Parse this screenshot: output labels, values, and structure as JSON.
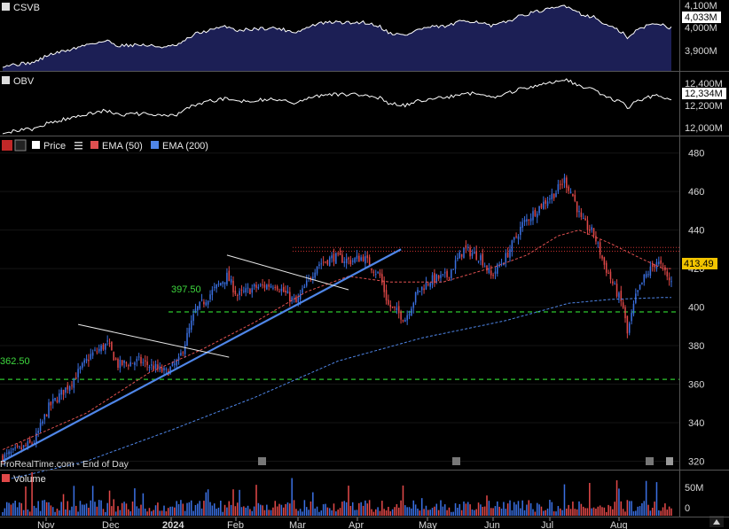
{
  "colors": {
    "background": "#000000",
    "up": "#3a6fe0",
    "down": "#e04848",
    "ema50": "#e05050",
    "ema200": "#4f86e8",
    "trendline": "#4f86e8",
    "support": "#2ec82e",
    "resistance": "#c83030",
    "csvb_fill": "#1c1f55",
    "last_price_badge": "#f2c400"
  },
  "panels": {
    "csvb": {
      "name": "CSVB",
      "ticks": [
        "4,100M",
        "4,000M",
        "3,900M"
      ],
      "last_label": "4,033M"
    },
    "obv": {
      "name": "OBV",
      "ticks": [
        "12,400M",
        "12,200M",
        "12,000M"
      ],
      "last_label": "12,334M"
    },
    "price": {
      "legend": {
        "price": "Price",
        "ema50": "EMA (50)",
        "ema200": "EMA (200)"
      },
      "watermark": "ProRealTime.com - End of Day",
      "support_labels": [
        "397.50",
        "362.50"
      ],
      "last_price": "413.49"
    },
    "volume": {
      "name": "Volume",
      "ticks": [
        "50M",
        "0"
      ]
    }
  },
  "chart_data": {
    "type": "candlestick",
    "x_labels": [
      "Nov",
      "Dec",
      "2024",
      "Feb",
      "Mar",
      "Apr",
      "May",
      "Jun",
      "Jul",
      "Aug"
    ],
    "y_ticks": [
      320,
      340,
      360,
      380,
      400,
      420,
      440,
      460,
      480
    ],
    "ylim": [
      317,
      484
    ],
    "support_levels": [
      397.5,
      362.5
    ],
    "resistance_levels": [
      431,
      429
    ],
    "ema50_anchors": [
      [
        0,
        326
      ],
      [
        40,
        345
      ],
      [
        70,
        366
      ],
      [
        95,
        378
      ],
      [
        120,
        392
      ],
      [
        145,
        408
      ],
      [
        165,
        416
      ],
      [
        185,
        413
      ],
      [
        210,
        413
      ],
      [
        235,
        421
      ],
      [
        250,
        427
      ],
      [
        265,
        437
      ],
      [
        275,
        440
      ],
      [
        290,
        433
      ],
      [
        305,
        425
      ],
      [
        315,
        420
      ]
    ],
    "ema200_anchors": [
      [
        0,
        310
      ],
      [
        40,
        320
      ],
      [
        80,
        336
      ],
      [
        120,
        353
      ],
      [
        160,
        372
      ],
      [
        200,
        384
      ],
      [
        240,
        393
      ],
      [
        270,
        402
      ],
      [
        290,
        404
      ],
      [
        315,
        405
      ]
    ],
    "price_anchors": [
      [
        0,
        322
      ],
      [
        8,
        326
      ],
      [
        15,
        330
      ],
      [
        22,
        348
      ],
      [
        32,
        360
      ],
      [
        42,
        375
      ],
      [
        50,
        381
      ],
      [
        55,
        370
      ],
      [
        65,
        372
      ],
      [
        78,
        366
      ],
      [
        84,
        372
      ],
      [
        92,
        398
      ],
      [
        100,
        408
      ],
      [
        107,
        416
      ],
      [
        112,
        406
      ],
      [
        120,
        410
      ],
      [
        130,
        412
      ],
      [
        140,
        402
      ],
      [
        150,
        422
      ],
      [
        158,
        426
      ],
      [
        166,
        424
      ],
      [
        172,
        426
      ],
      [
        180,
        416
      ],
      [
        184,
        401
      ],
      [
        192,
        394
      ],
      [
        198,
        408
      ],
      [
        204,
        414
      ],
      [
        212,
        416
      ],
      [
        220,
        430
      ],
      [
        228,
        426
      ],
      [
        233,
        416
      ],
      [
        240,
        426
      ],
      [
        248,
        443
      ],
      [
        256,
        452
      ],
      [
        264,
        460
      ],
      [
        268,
        466
      ],
      [
        272,
        458
      ],
      [
        276,
        445
      ],
      [
        282,
        438
      ],
      [
        287,
        422
      ],
      [
        292,
        410
      ],
      [
        296,
        400
      ],
      [
        298,
        386
      ],
      [
        302,
        405
      ],
      [
        306,
        415
      ],
      [
        312,
        424
      ],
      [
        316,
        418
      ],
      [
        318,
        413.5
      ]
    ],
    "candle_count": 320,
    "annotations": {
      "uptrend_line": {
        "from": [
          0,
          320
        ],
        "to": [
          190,
          430
        ]
      },
      "down_line_1": {
        "from": [
          36,
          391
        ],
        "to": [
          108,
          374
        ]
      },
      "down_line_2": {
        "from": [
          107,
          427
        ],
        "to": [
          165,
          409
        ]
      }
    }
  }
}
